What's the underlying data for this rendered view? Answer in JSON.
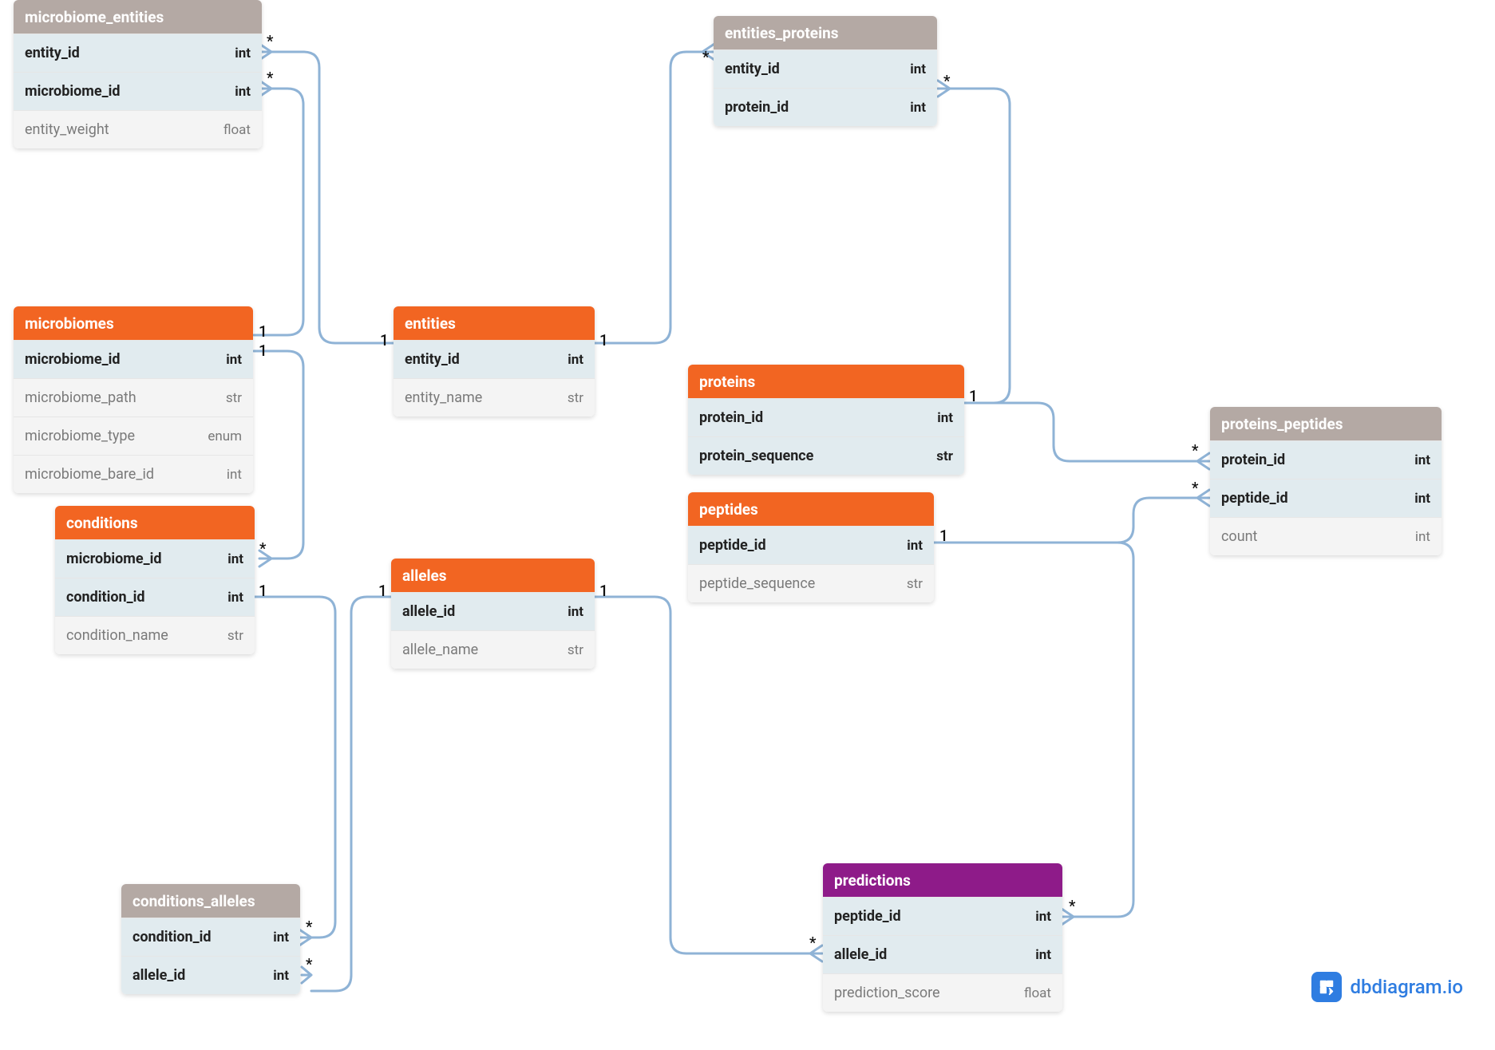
{
  "brand": "dbdiagram.io",
  "card": {
    "one": "1",
    "many": "*"
  },
  "tables": {
    "microbiome_entities": {
      "title": "microbiome_entities",
      "header_color": "#b4a9a4",
      "cols": [
        {
          "name": "entity_id",
          "type": "int",
          "pk": true
        },
        {
          "name": "microbiome_id",
          "type": "int",
          "pk": true
        },
        {
          "name": "entity_weight",
          "type": "float",
          "pk": false
        }
      ]
    },
    "microbiomes": {
      "title": "microbiomes",
      "header_color": "#f26522",
      "cols": [
        {
          "name": "microbiome_id",
          "type": "int",
          "pk": true
        },
        {
          "name": "microbiome_path",
          "type": "str",
          "pk": false
        },
        {
          "name": "microbiome_type",
          "type": "enum",
          "pk": false
        },
        {
          "name": "microbiome_bare_id",
          "type": "int",
          "pk": false
        }
      ]
    },
    "conditions": {
      "title": "conditions",
      "header_color": "#f26522",
      "cols": [
        {
          "name": "microbiome_id",
          "type": "int",
          "pk": true
        },
        {
          "name": "condition_id",
          "type": "int",
          "pk": true
        },
        {
          "name": "condition_name",
          "type": "str",
          "pk": false
        }
      ]
    },
    "conditions_alleles": {
      "title": "conditions_alleles",
      "header_color": "#b4a9a4",
      "cols": [
        {
          "name": "condition_id",
          "type": "int",
          "pk": true
        },
        {
          "name": "allele_id",
          "type": "int",
          "pk": true
        }
      ]
    },
    "entities": {
      "title": "entities",
      "header_color": "#f26522",
      "cols": [
        {
          "name": "entity_id",
          "type": "int",
          "pk": true
        },
        {
          "name": "entity_name",
          "type": "str",
          "pk": false
        }
      ]
    },
    "alleles": {
      "title": "alleles",
      "header_color": "#f26522",
      "cols": [
        {
          "name": "allele_id",
          "type": "int",
          "pk": true
        },
        {
          "name": "allele_name",
          "type": "str",
          "pk": false
        }
      ]
    },
    "entities_proteins": {
      "title": "entities_proteins",
      "header_color": "#b4a9a4",
      "cols": [
        {
          "name": "entity_id",
          "type": "int",
          "pk": true
        },
        {
          "name": "protein_id",
          "type": "int",
          "pk": true
        }
      ]
    },
    "proteins": {
      "title": "proteins",
      "header_color": "#f26522",
      "cols": [
        {
          "name": "protein_id",
          "type": "int",
          "pk": true
        },
        {
          "name": "protein_sequence",
          "type": "str",
          "pk": true
        }
      ]
    },
    "peptides": {
      "title": "peptides",
      "header_color": "#f26522",
      "cols": [
        {
          "name": "peptide_id",
          "type": "int",
          "pk": true
        },
        {
          "name": "peptide_sequence",
          "type": "str",
          "pk": false
        }
      ]
    },
    "predictions": {
      "title": "predictions",
      "header_color": "#8e1b89",
      "cols": [
        {
          "name": "peptide_id",
          "type": "int",
          "pk": true
        },
        {
          "name": "allele_id",
          "type": "int",
          "pk": true
        },
        {
          "name": "prediction_score",
          "type": "float",
          "pk": false
        }
      ]
    },
    "proteins_peptides": {
      "title": "proteins_peptides",
      "header_color": "#b4a9a4",
      "cols": [
        {
          "name": "protein_id",
          "type": "int",
          "pk": true
        },
        {
          "name": "peptide_id",
          "type": "int",
          "pk": true
        },
        {
          "name": "count",
          "type": "int",
          "pk": false
        }
      ]
    }
  },
  "relationships": [
    {
      "from": "entities.entity_id",
      "from_card": "1",
      "to": "microbiome_entities.entity_id",
      "to_card": "*"
    },
    {
      "from": "microbiomes.microbiome_id",
      "from_card": "1",
      "to": "microbiome_entities.microbiome_id",
      "to_card": "*"
    },
    {
      "from": "microbiomes.microbiome_id",
      "from_card": "1",
      "to": "conditions.microbiome_id",
      "to_card": "*"
    },
    {
      "from": "conditions.condition_id",
      "from_card": "1",
      "to": "conditions_alleles.condition_id",
      "to_card": "*"
    },
    {
      "from": "alleles.allele_id",
      "from_card": "1",
      "to": "conditions_alleles.allele_id",
      "to_card": "*"
    },
    {
      "from": "alleles.allele_id",
      "from_card": "1",
      "to": "predictions.allele_id",
      "to_card": "*"
    },
    {
      "from": "entities.entity_id",
      "from_card": "1",
      "to": "entities_proteins.entity_id",
      "to_card": "*"
    },
    {
      "from": "proteins.protein_id",
      "from_card": "1",
      "to": "entities_proteins.protein_id",
      "to_card": "*"
    },
    {
      "from": "proteins.protein_id",
      "from_card": "1",
      "to": "proteins_peptides.protein_id",
      "to_card": "*"
    },
    {
      "from": "peptides.peptide_id",
      "from_card": "1",
      "to": "proteins_peptides.peptide_id",
      "to_card": "*"
    },
    {
      "from": "peptides.peptide_id",
      "from_card": "1",
      "to": "predictions.peptide_id",
      "to_card": "*"
    }
  ]
}
